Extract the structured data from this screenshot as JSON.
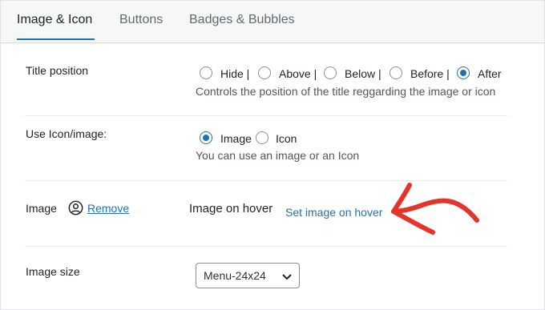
{
  "tabs": [
    {
      "label": "Image & Icon",
      "active": true
    },
    {
      "label": "Buttons",
      "active": false
    },
    {
      "label": "Badges & Bubbles",
      "active": false
    }
  ],
  "title_position": {
    "label": "Title position",
    "options": [
      "Hide |",
      "Above |",
      "Below |",
      "Before |",
      "After"
    ],
    "selected": "After",
    "description": "Controls the position of the title reggarding the image or icon"
  },
  "use_icon_image": {
    "label": "Use Icon/image:",
    "options": [
      "Image",
      "Icon"
    ],
    "selected": "Image",
    "description": "You can use an image or an Icon"
  },
  "image": {
    "label": "Image",
    "remove_link": "Remove",
    "icon": "user-circle-icon",
    "hover_label": "Image on hover",
    "set_hover_link": "Set image on hover",
    "annotation_icon": "red-arrow-icon"
  },
  "image_size": {
    "label": "Image size",
    "selected": "Menu-24x24"
  },
  "colors": {
    "accent": "#2271b1",
    "annotation": "#e5352b"
  }
}
